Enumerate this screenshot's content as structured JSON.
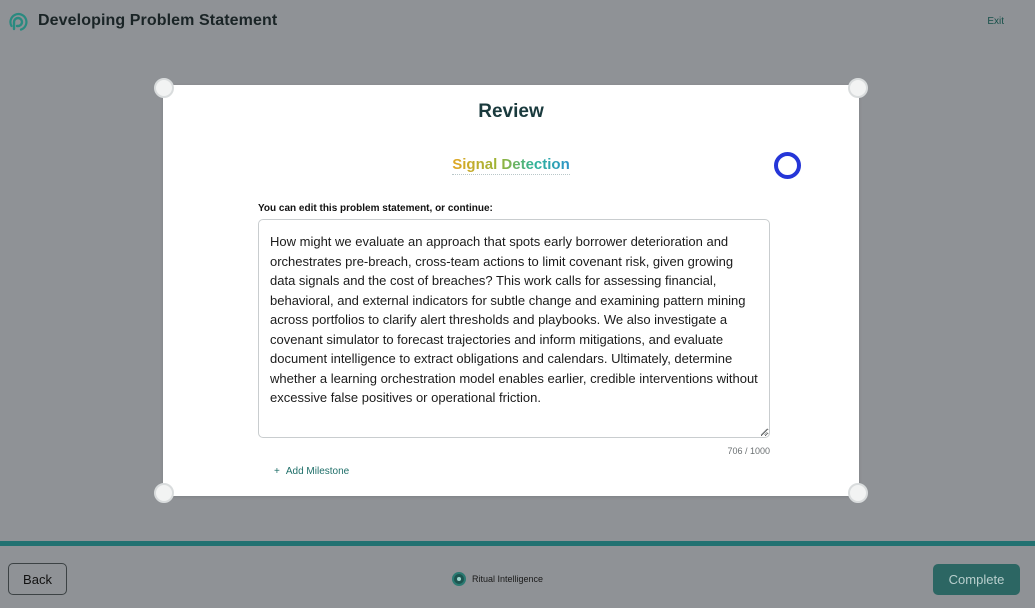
{
  "header": {
    "title": "Developing Problem Statement",
    "exit_label": "Exit",
    "logo_icon": "ritual-logo-icon"
  },
  "card": {
    "title": "Review",
    "section_title": "Signal Detection",
    "edit_label": "You can edit this problem statement, or continue:",
    "problem_statement": "How might we evaluate an approach that spots early borrower deterioration and orchestrates pre-breach, cross-team actions to limit covenant risk, given growing data signals and the cost of breaches? This work calls for assessing financial, behavioral, and external indicators for subtle change and examining pattern mining across portfolios to clarify alert thresholds and playbooks. We also investigate a covenant simulator to forecast trajectories and inform mitigations, and evaluate document intelligence to extract obligations and calendars. Ultimately, determine whether a learning orchestration model enables earlier, credible interventions without excessive false positives or operational friction.",
    "char_count": "706 / 1000",
    "add_milestone_label": "Add Milestone",
    "add_milestone_icon": "+"
  },
  "footer": {
    "back_label": "Back",
    "brand_label": "Ritual Intelligence",
    "complete_label": "Complete"
  },
  "colors": {
    "accent": "#227171",
    "ring": "#2536d8",
    "complete_bg": "#2c6663"
  }
}
